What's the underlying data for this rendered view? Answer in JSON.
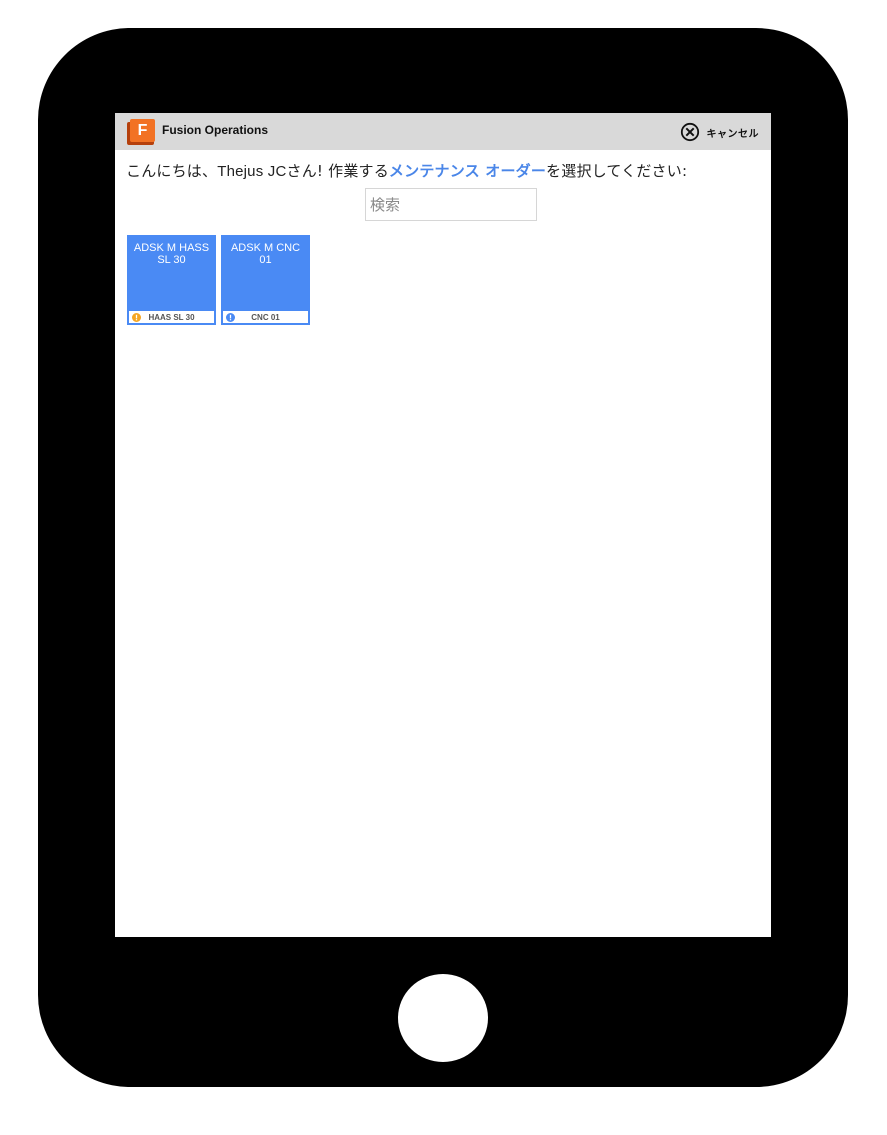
{
  "app": {
    "logo_letter": "F",
    "title": "Fusion Operations"
  },
  "header": {
    "cancel_label": "キャンセル"
  },
  "greeting": {
    "prefix": "こんにちは、",
    "user_name": "Thejus JC",
    "middle": "さん! 作業する",
    "highlight": "メンテナンス オーダー",
    "suffix": "を選択してください:"
  },
  "search": {
    "placeholder": "検索",
    "value": ""
  },
  "colors": {
    "tile_blue": "#4a8af4",
    "highlight_blue": "#4a86e8",
    "warning_orange": "#f5a623",
    "info_blue": "#4a8af4",
    "logo_orange": "#f27224"
  },
  "orders": [
    {
      "title": "ADSK M HASS SL 30",
      "code": "HAAS SL 30",
      "status_icon": "warning-icon"
    },
    {
      "title": "ADSK M CNC 01",
      "code": "CNC 01",
      "status_icon": "info-icon"
    }
  ]
}
